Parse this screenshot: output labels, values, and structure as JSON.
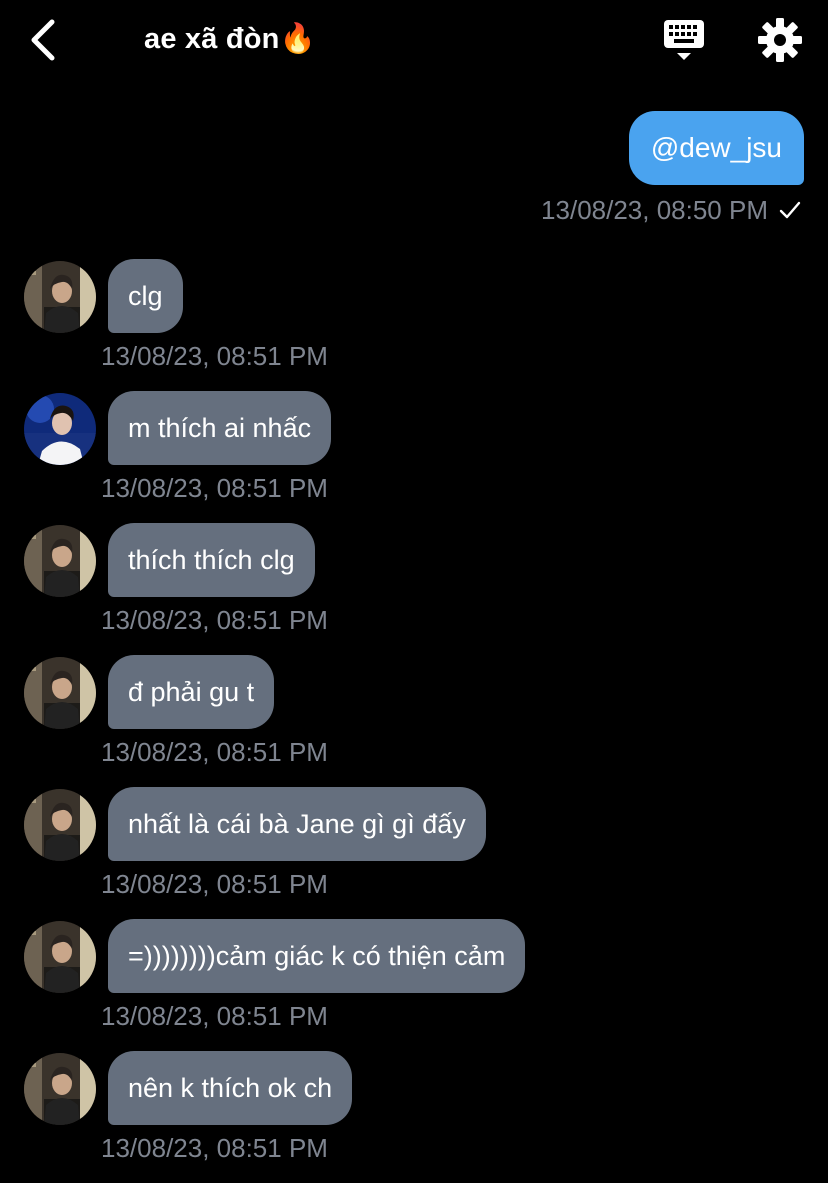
{
  "header": {
    "back_icon": "chevron-left-icon",
    "title": "ae xã đòn🔥",
    "keyboard_icon": "keyboard-icon",
    "settings_icon": "gear-icon"
  },
  "outgoing": {
    "text": "@dew_jsu",
    "timestamp": "13/08/23, 08:50 PM",
    "status_icon": "checkmark-icon",
    "bubble_color": "#4aa3ef"
  },
  "messages": [
    {
      "text": "clg",
      "timestamp": "13/08/23, 08:51 PM",
      "avatar": "avatar-a"
    },
    {
      "text": "m thích ai nhấc",
      "timestamp": "13/08/23, 08:51 PM",
      "avatar": "avatar-b"
    },
    {
      "text": "thích thích clg",
      "timestamp": "13/08/23, 08:51 PM",
      "avatar": "avatar-a"
    },
    {
      "text": "đ phải gu t",
      "timestamp": "13/08/23, 08:51 PM",
      "avatar": "avatar-a"
    },
    {
      "text": "nhất là cái bà Jane gì gì đấy",
      "timestamp": "13/08/23, 08:51 PM",
      "avatar": "avatar-a"
    },
    {
      "text": "=))))))))cảm giác k có thiện cảm",
      "timestamp": "13/08/23, 08:51 PM",
      "avatar": "avatar-a"
    },
    {
      "text": "nên k thích ok ch",
      "timestamp": "13/08/23, 08:51 PM",
      "avatar": "avatar-a"
    }
  ],
  "colors": {
    "background": "#000000",
    "incoming_bubble": "#656f7e",
    "timestamp_text": "#7f8590"
  }
}
